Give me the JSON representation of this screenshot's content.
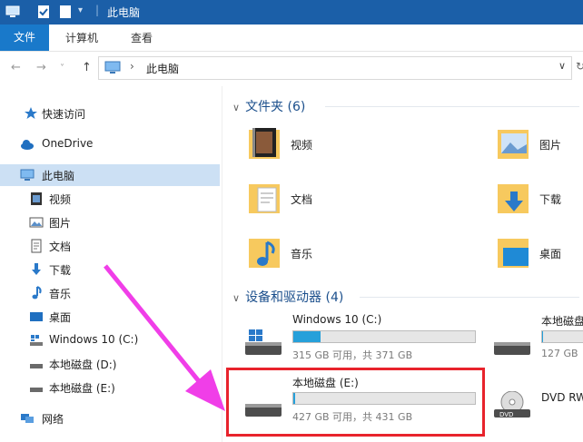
{
  "window": {
    "title": "此电脑"
  },
  "ribbon": {
    "tabs": [
      "文件",
      "计算机",
      "查看"
    ]
  },
  "address": {
    "crumb": "此电脑",
    "sep": "›"
  },
  "nav": {
    "quick_access": "快速访问",
    "onedrive": "OneDrive",
    "this_pc": "此电脑",
    "items": [
      "视频",
      "图片",
      "文档",
      "下载",
      "音乐",
      "桌面",
      "Windows 10 (C:)",
      "本地磁盘 (D:)",
      "本地磁盘 (E:)"
    ],
    "network": "网络"
  },
  "main": {
    "folders_header": "文件夹 (6)",
    "folders": [
      "视频",
      "图片",
      "文档",
      "下载",
      "音乐",
      "桌面"
    ],
    "devices_header": "设备和驱动器 (4)",
    "drives": [
      {
        "name": "Windows 10 (C:)",
        "info": "315 GB 可用，共 371 GB",
        "used_fraction": 0.15
      },
      {
        "name": "本地磁盘",
        "info": "127 GB",
        "used_fraction": 0.02
      },
      {
        "name": "本地磁盘 (E:)",
        "info": "427 GB 可用，共 431 GB",
        "used_fraction": 0.01
      },
      {
        "name": "DVD RW",
        "info": ""
      }
    ]
  },
  "colors": {
    "titlebar": "#1b5fa8",
    "file_tab": "#1979ca",
    "bar_fill": "#26a0da",
    "highlight": "#e8232c",
    "arrow": "#f03ee8"
  }
}
